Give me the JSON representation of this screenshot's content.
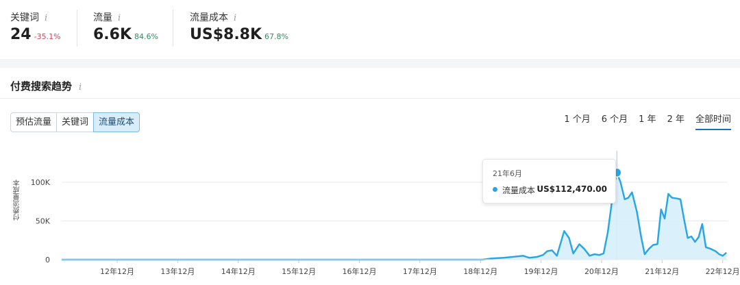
{
  "metrics": [
    {
      "label": "关键词",
      "value": "24",
      "change": "-35.1%",
      "trend": "neg"
    },
    {
      "label": "流量",
      "value": "6.6K",
      "change": "84.6%",
      "trend": "pos"
    },
    {
      "label": "流量成本",
      "value": "US$8.8K",
      "change": "67.8%",
      "trend": "pos"
    }
  ],
  "info_icon": "i",
  "section": {
    "title": "付费搜索趋势"
  },
  "tabs": [
    {
      "label": "预估流量",
      "active": false
    },
    {
      "label": "关键词",
      "active": false
    },
    {
      "label": "流量成本",
      "active": true
    }
  ],
  "ranges": [
    {
      "label": "1 个月",
      "active": false
    },
    {
      "label": "6 个月",
      "active": false
    },
    {
      "label": "1 年",
      "active": false
    },
    {
      "label": "2 年",
      "active": false
    },
    {
      "label": "全部时间",
      "active": true
    }
  ],
  "tooltip": {
    "date": "21年6月",
    "series": "流量成本",
    "value": "US$112,470.00"
  },
  "colors": {
    "series": "#2aa6e6",
    "fill": "#d6eefb",
    "accent": "#1b6fc2"
  },
  "chart_data": {
    "type": "area",
    "ylabel": "付费流量成本",
    "ylim": [
      0,
      120000
    ],
    "y_ticks": [
      {
        "value": 0,
        "label": "0"
      },
      {
        "value": 50000,
        "label": "50K"
      },
      {
        "value": 100000,
        "label": "100K"
      }
    ],
    "x_ticks": [
      {
        "label": "12年12月",
        "t": 2012.917
      },
      {
        "label": "13年12月",
        "t": 2013.917
      },
      {
        "label": "14年12月",
        "t": 2014.917
      },
      {
        "label": "15年12月",
        "t": 2015.917
      },
      {
        "label": "16年12月",
        "t": 2016.917
      },
      {
        "label": "17年12月",
        "t": 2017.917
      },
      {
        "label": "18年12月",
        "t": 2018.917
      },
      {
        "label": "19年12月",
        "t": 2019.917
      },
      {
        "label": "20年12月",
        "t": 2020.917
      },
      {
        "label": "21年12月",
        "t": 2021.917
      },
      {
        "label": "22年12月",
        "t": 2022.917
      }
    ],
    "x_range": [
      2012.0,
      2023.0
    ],
    "grid": "horizontal",
    "series": [
      {
        "name": "流量成本",
        "points": [
          [
            2012.0,
            0
          ],
          [
            2018.95,
            0
          ],
          [
            2019.1,
            1500
          ],
          [
            2019.3,
            2500
          ],
          [
            2019.5,
            4000
          ],
          [
            2019.62,
            5000
          ],
          [
            2019.72,
            2500
          ],
          [
            2019.85,
            3500
          ],
          [
            2019.95,
            6000
          ],
          [
            2020.02,
            11000
          ],
          [
            2020.1,
            12000
          ],
          [
            2020.18,
            5000
          ],
          [
            2020.3,
            37000
          ],
          [
            2020.38,
            28000
          ],
          [
            2020.45,
            8000
          ],
          [
            2020.55,
            20000
          ],
          [
            2020.63,
            14000
          ],
          [
            2020.72,
            5000
          ],
          [
            2020.8,
            7000
          ],
          [
            2020.88,
            6000
          ],
          [
            2020.95,
            8000
          ],
          [
            2021.02,
            35000
          ],
          [
            2021.08,
            70000
          ],
          [
            2021.13,
            98000
          ],
          [
            2021.17,
            112470
          ],
          [
            2021.23,
            100000
          ],
          [
            2021.3,
            78000
          ],
          [
            2021.36,
            80000
          ],
          [
            2021.42,
            87000
          ],
          [
            2021.5,
            62000
          ],
          [
            2021.57,
            30000
          ],
          [
            2021.63,
            7000
          ],
          [
            2021.7,
            14000
          ],
          [
            2021.77,
            19000
          ],
          [
            2021.84,
            20000
          ],
          [
            2021.9,
            65000
          ],
          [
            2021.96,
            53000
          ],
          [
            2022.02,
            85000
          ],
          [
            2022.08,
            80000
          ],
          [
            2022.16,
            79000
          ],
          [
            2022.22,
            78000
          ],
          [
            2022.28,
            52000
          ],
          [
            2022.34,
            28000
          ],
          [
            2022.4,
            30000
          ],
          [
            2022.46,
            23000
          ],
          [
            2022.52,
            29000
          ],
          [
            2022.58,
            46000
          ],
          [
            2022.64,
            16000
          ],
          [
            2022.72,
            14000
          ],
          [
            2022.8,
            11000
          ],
          [
            2022.86,
            7000
          ],
          [
            2022.92,
            5000
          ],
          [
            2022.98,
            9000
          ]
        ]
      }
    ],
    "highlight": {
      "t": 2021.17,
      "value": 112470
    }
  }
}
